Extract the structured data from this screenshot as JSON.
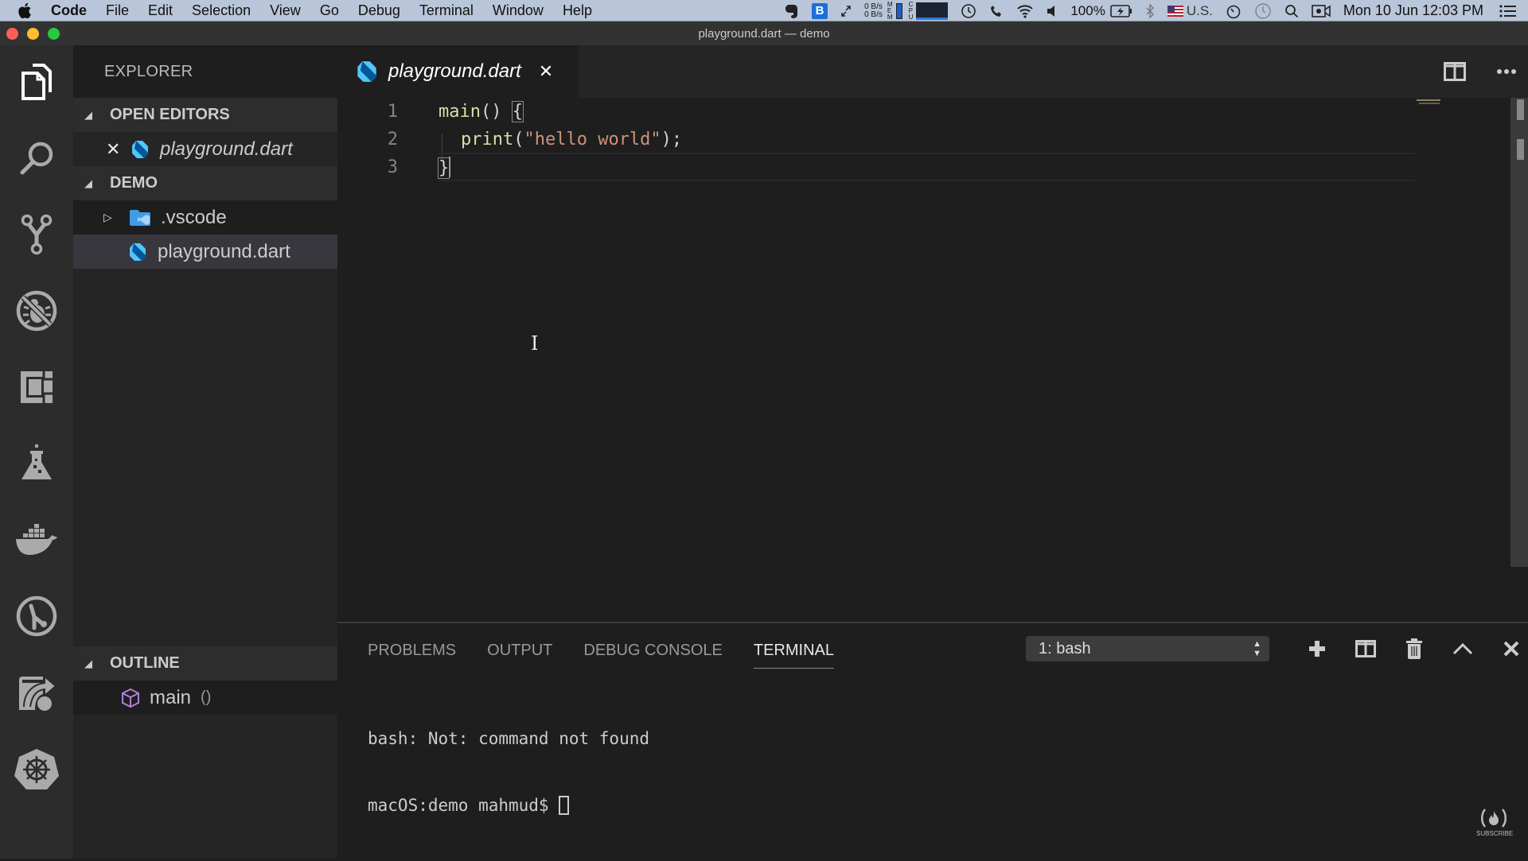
{
  "menubar": {
    "app_name": "Code",
    "items": [
      "File",
      "Edit",
      "Selection",
      "View",
      "Go",
      "Debug",
      "Terminal",
      "Window",
      "Help"
    ],
    "net_up": "0 B/s",
    "net_down": "0 B/s",
    "mem_label": "MEM",
    "cpu_label": "CPU",
    "battery": "100%",
    "input_source": "U.S.",
    "datetime": "Mon 10 Jun  12:03 PM"
  },
  "window": {
    "title": "playground.dart — demo"
  },
  "activity_bar": {
    "items": [
      "explorer",
      "search",
      "source-control",
      "debug",
      "extensions",
      "test",
      "docker",
      "gitlens",
      "live-share",
      "kubernetes"
    ]
  },
  "sidebar": {
    "title": "EXPLORER",
    "open_editors": {
      "label": "OPEN EDITORS",
      "files": [
        {
          "name": "playground.dart"
        }
      ]
    },
    "folder": {
      "label": "DEMO",
      "items": [
        {
          "name": ".vscode",
          "type": "folder"
        },
        {
          "name": "playground.dart",
          "type": "dart"
        }
      ]
    },
    "outline": {
      "label": "OUTLINE",
      "items": [
        {
          "name": "main",
          "detail": "()"
        }
      ]
    }
  },
  "editor": {
    "tab": {
      "label": "playground.dart",
      "close": "×"
    },
    "lines": [
      {
        "num": "1",
        "fn": "main",
        "rest": "() ",
        "brace": "{"
      },
      {
        "num": "2",
        "fn": "print",
        "open": "(",
        "str": "\"hello world\"",
        "close": ");"
      },
      {
        "num": "3",
        "brace": "}"
      }
    ]
  },
  "panel": {
    "tabs": [
      "PROBLEMS",
      "OUTPUT",
      "DEBUG CONSOLE",
      "TERMINAL"
    ],
    "active_tab": "TERMINAL",
    "terminal_select": "1: bash",
    "terminal_lines": [
      "bash: Not: command not found",
      "macOS:demo mahmud$ "
    ]
  },
  "badge": {
    "label": "SUBSCRIBE"
  },
  "colors": {
    "dart_light": "#54c5f8",
    "dart_dark": "#01579b",
    "outline_icon": "#b180d7",
    "string": "#ce9178",
    "function": "#dcdcaa"
  }
}
